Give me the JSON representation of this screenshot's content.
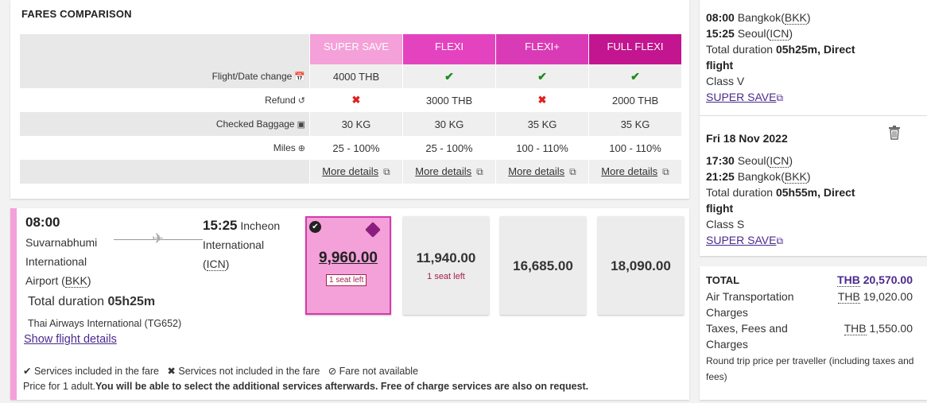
{
  "fares": {
    "title": "FARES COMPARISON",
    "columns": [
      "SUPER SAVE",
      "FLEXI",
      "FLEXI+",
      "FULL FLEXI"
    ],
    "column_colors": [
      "#f4a0d9",
      "#e443c0",
      "#d93bb6",
      "#c2158f"
    ],
    "rows": [
      {
        "label": "Flight/Date change",
        "icon": "calendar-icon",
        "cells": [
          {
            "text": "4000 THB"
          },
          {
            "icon": "check"
          },
          {
            "icon": "check"
          },
          {
            "icon": "check"
          }
        ]
      },
      {
        "label": "Refund",
        "icon": "refund-icon",
        "cells": [
          {
            "icon": "cross"
          },
          {
            "text": "3000 THB"
          },
          {
            "icon": "cross"
          },
          {
            "text": "2000 THB"
          }
        ]
      },
      {
        "label": "Checked Baggage",
        "icon": "baggage-icon",
        "cells": [
          {
            "text": "30 KG"
          },
          {
            "text": "30 KG"
          },
          {
            "text": "35 KG"
          },
          {
            "text": "35 KG"
          }
        ]
      },
      {
        "label": "Miles",
        "icon": "plus-circle-icon",
        "cells": [
          {
            "text": "25 - 100%"
          },
          {
            "text": "25 - 100%"
          },
          {
            "text": "100 - 110%"
          },
          {
            "text": "100 - 110%"
          }
        ]
      }
    ],
    "more_details": "More details"
  },
  "flight": {
    "dep_time": "08:00",
    "dep_airport_line1": "Suvarnabhumi",
    "dep_airport_line2": "International",
    "dep_airport_line3": "Airport (",
    "dep_code": "BKK",
    "dep_close": ")",
    "arr_time": "15:25",
    "arr_city": "Incheon",
    "arr_line2": "International",
    "arr_code": "ICN",
    "duration_label": "Total duration",
    "duration": "05h25m",
    "airline": "Thai Airways International (TG652)",
    "show_details": "Show flight details",
    "fares": [
      {
        "amount": "9,960.00",
        "seats": "1 seat left",
        "selected": true
      },
      {
        "amount": "11,940.00",
        "seats": "1 seat left"
      },
      {
        "amount": "16,685.00",
        "seats": ""
      },
      {
        "amount": "18,090.00",
        "seats": ""
      }
    ],
    "legend": {
      "included": "Services included in the fare",
      "not_included": "Services not included in the fare",
      "not_available": "Fare not available"
    },
    "note_plain": "Price for 1 adult.",
    "note_bold": "You will be able to select the additional services afterwards. Free of charge services are also on request."
  },
  "itinerary": {
    "out": {
      "dep_time": "08:00",
      "dep_city": "Bangkok",
      "dep_code": "BKK",
      "arr_time": "15:25",
      "arr_city": "Seoul",
      "arr_code": "ICN",
      "duration_label": "Total duration",
      "duration": "05h25m, Direct",
      "duration2": "flight",
      "class": "Class V",
      "fare": "SUPER SAVE"
    },
    "ret": {
      "date": "Fri 18 Nov 2022",
      "dep_time": "17:30",
      "dep_city": "Seoul",
      "dep_code": "ICN",
      "arr_time": "21:25",
      "arr_city": "Bangkok",
      "arr_code": "BKK",
      "duration_label": "Total duration",
      "duration": "05h55m, Direct",
      "duration2": "flight",
      "class": "Class S",
      "fare": "SUPER SAVE"
    }
  },
  "total": {
    "label": "TOTAL",
    "currency": "THB",
    "amount": "20,570.00",
    "air_label1": "Air Transportation",
    "air_label2": "Charges",
    "air_amount": "19,020.00",
    "tax_label1": "Taxes, Fees and",
    "tax_label2": "Charges",
    "tax_amount": "1,550.00",
    "note": "Round trip price per traveller (including taxes and fees)"
  }
}
